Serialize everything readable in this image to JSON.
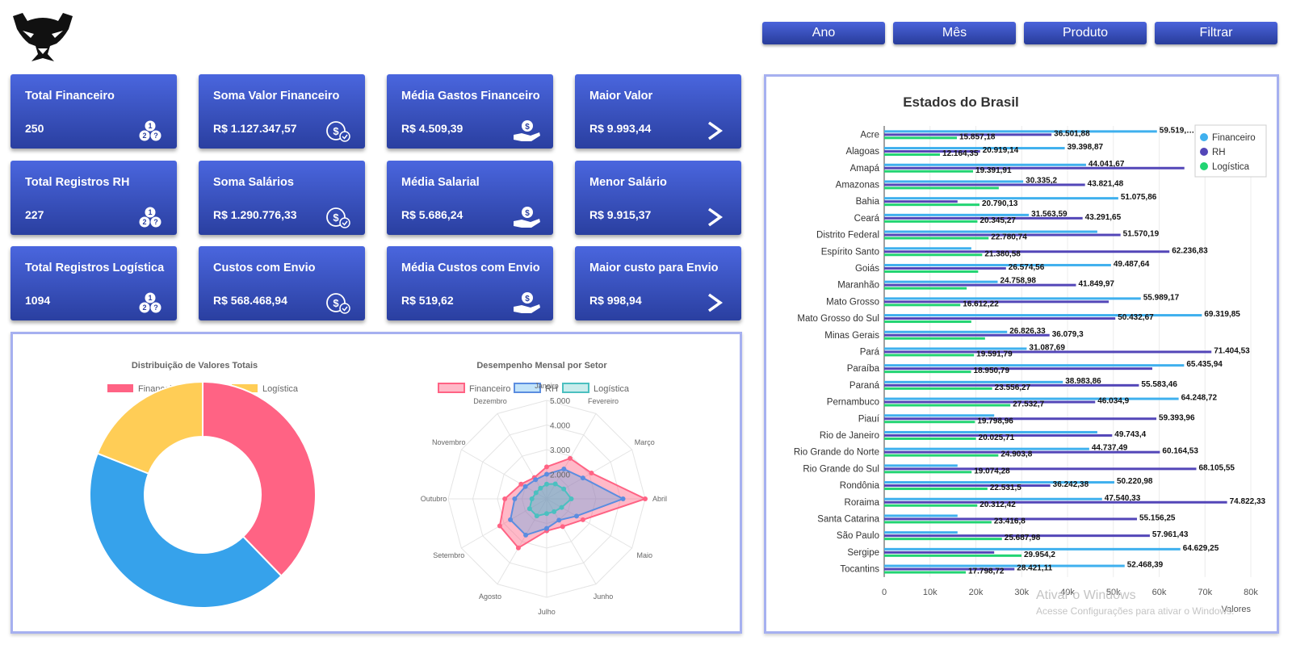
{
  "header": {
    "buttons": [
      "Ano",
      "Mês",
      "Produto",
      "Filtrar"
    ]
  },
  "icons": {
    "logo": "panda-logo",
    "counter": "numbered-coins-icon",
    "money": "money-check-icon",
    "hand": "money-hand-icon",
    "arrow": "chevron-right-icon"
  },
  "cards": [
    {
      "title": "Total Financeiro",
      "value": "250",
      "icon": "counter"
    },
    {
      "title": "Soma Valor Financeiro",
      "value": "R$ 1.127.347,57",
      "icon": "money"
    },
    {
      "title": "Média Gastos Financeiro",
      "value": "R$ 4.509,39",
      "icon": "hand"
    },
    {
      "title": "Maior Valor",
      "value": "R$ 9.993,44",
      "icon": "arrow"
    },
    {
      "title": "Total Registros RH",
      "value": "227",
      "icon": "counter"
    },
    {
      "title": "Soma Salários",
      "value": "R$ 1.290.776,33",
      "icon": "money"
    },
    {
      "title": "Média Salarial",
      "value": "R$ 5.686,24",
      "icon": "hand"
    },
    {
      "title": "Menor Salário",
      "value": "R$ 9.915,37",
      "icon": "arrow"
    },
    {
      "title": "Total Registros Logística",
      "value": "1094",
      "icon": "counter"
    },
    {
      "title": "Custos com Envio",
      "value": "R$ 568.468,94",
      "icon": "money"
    },
    {
      "title": "Média Custos com Envio",
      "value": "R$ 519,62",
      "icon": "hand"
    },
    {
      "title": "Maior custo para Envio",
      "value": "R$ 998,94",
      "icon": "arrow"
    }
  ],
  "colors": {
    "financeiro": "#ff6384",
    "rh": "#36a2eb",
    "logistica": "#ffcd56",
    "bar_financeiro": "#3fb0ee",
    "bar_rh": "#5346b8",
    "bar_logistica": "#22d472"
  },
  "watermark": {
    "line1": "Ativar o Windows",
    "line2": "Acesse Configurações para ativar o Windows."
  },
  "chart_data": [
    {
      "type": "pie",
      "variant": "doughnut",
      "title": "Distribuição de Valores Totais",
      "legend_position": "top",
      "categories": [
        "Financeiro",
        "RH",
        "Logística"
      ],
      "values": [
        1127347.57,
        1290776.33,
        568468.94
      ],
      "colors": [
        "#ff6384",
        "#36a2eb",
        "#ffcd56"
      ]
    },
    {
      "type": "radar",
      "title": "Desempenho Mensal por Setor",
      "legend_position": "top",
      "categories": [
        "Janeiro",
        "Fevereiro",
        "Março",
        "Abril",
        "Maio",
        "Junho",
        "Julho",
        "Agosto",
        "Setembro",
        "Outubro",
        "Novembro",
        "Dezembro"
      ],
      "r_ticks": [
        "2.000",
        "3.000",
        "4.000",
        "5.000"
      ],
      "r_range": [
        1000,
        5000
      ],
      "series": [
        {
          "name": "Financeiro",
          "values": [
            2300,
            2900,
            3100,
            5000,
            2700,
            2300,
            2300,
            3300,
            3200,
            2700,
            2200,
            2000
          ],
          "stroke": "#ff6384",
          "fill": "rgba(255,99,132,0.45)"
        },
        {
          "name": "RH",
          "values": [
            2000,
            2400,
            2700,
            4100,
            2400,
            2000,
            2200,
            2700,
            2700,
            2300,
            2000,
            1900
          ],
          "stroke": "#5b8de0",
          "fill": "rgba(54,162,235,0.30)"
        },
        {
          "name": "Logística",
          "values": [
            1600,
            1700,
            1800,
            2000,
            1700,
            1600,
            1600,
            1800,
            1800,
            1600,
            1500,
            1500
          ],
          "stroke": "#4bc0c0",
          "fill": "rgba(75,192,192,0.30)"
        }
      ]
    },
    {
      "type": "bar",
      "orientation": "horizontal",
      "title": "Estados do Brasil",
      "xlabel": "Valores",
      "xlim": [
        0,
        80000
      ],
      "x_ticks": [
        "0",
        "10k",
        "20k",
        "30k",
        "40k",
        "50k",
        "60k",
        "70k",
        "80k"
      ],
      "legend_position": "top-right",
      "categories": [
        "Acre",
        "Alagoas",
        "Amapá",
        "Amazonas",
        "Bahia",
        "Ceará",
        "Distrito Federal",
        "Espírito Santo",
        "Goiás",
        "Maranhão",
        "Mato Grosso",
        "Mato Grosso do Sul",
        "Minas Gerais",
        "Pará",
        "Paraíba",
        "Paraná",
        "Pernambuco",
        "Piauí",
        "Rio de Janeiro",
        "Rio Grande do Norte",
        "Rio Grande do Sul",
        "Rondônia",
        "Roraima",
        "Santa Catarina",
        "São Paulo",
        "Sergipe",
        "Tocantins"
      ],
      "series": [
        {
          "name": "Financeiro",
          "values": [
            59519,
            39398.87,
            44041.67,
            30335.2,
            51075.86,
            31563.59,
            46500,
            19000,
            49487.64,
            24758.98,
            55989.17,
            69319.85,
            26826.33,
            31087.69,
            65435.94,
            38983.86,
            64248.72,
            24000,
            46500,
            44737.49,
            16000,
            50220.98,
            47540.33,
            16000,
            16000,
            64629.25,
            52468.39
          ],
          "labels": [
            "59.519,…",
            "39.398,87",
            "44.041,67",
            "30.335,2",
            "51.075,86",
            "31.563,59",
            "",
            "",
            "49.487,64",
            "24.758,98",
            "55.989,17",
            "69.319,85",
            "26.826,33",
            "31.087,69",
            "65.435,94",
            "38.983,86",
            "64.248,72",
            "",
            "",
            "44.737,49",
            "",
            "50.220,98",
            "47.540,33",
            "",
            "",
            "64.629,25",
            "52.468,39"
          ]
        },
        {
          "name": "RH",
          "values": [
            36501.88,
            20919.14,
            65500,
            43821.48,
            16000,
            43291.65,
            51570.19,
            62236.83,
            26574.56,
            41849.97,
            49000,
            50432.67,
            36079.3,
            71404.53,
            58500,
            55583.46,
            46034.9,
            59393.96,
            49743.4,
            60164.53,
            68105.55,
            36242.38,
            74822.33,
            55156.25,
            57961.43,
            24000,
            28421.11
          ],
          "labels": [
            "36.501,88",
            "20.919,14",
            "",
            "43.821,48",
            "",
            "43.291,65",
            "51.570,19",
            "62.236,83",
            "26.574,56",
            "41.849,97",
            "",
            "50.432,67",
            "36.079,3",
            "71.404,53",
            "",
            "55.583,46",
            "46.034,9",
            "59.393,96",
            "49.743,4",
            "60.164,53",
            "68.105,55",
            "36.242,38",
            "74.822,33",
            "55.156,25",
            "57.961,43",
            "",
            "28.421,11"
          ]
        },
        {
          "name": "Logística",
          "values": [
            15857.18,
            12164.35,
            19391.91,
            25000,
            20790.13,
            20345.27,
            22780.74,
            21380.58,
            20500,
            18000,
            16612.22,
            19000,
            22000,
            19591.79,
            18950.79,
            23556.27,
            27532.7,
            19798.96,
            20025.71,
            24903.8,
            19074.28,
            22531.5,
            20312.42,
            23416.8,
            25687.98,
            29954.2,
            17798.72
          ],
          "labels": [
            "15.857,18",
            "12.164,35",
            "19.391,91",
            "",
            "20.790,13",
            "20.345,27",
            "22.780,74",
            "21.380,58",
            "",
            "",
            "16.612,22",
            "",
            "",
            "19.591,79",
            "18.950,79",
            "23.556,27",
            "27.532,7",
            "19.798,96",
            "20.025,71",
            "24.903,8",
            "19.074,28",
            "22.531,5",
            "20.312,42",
            "23.416,8",
            "25.687,98",
            "29.954,2",
            "17.798,72"
          ]
        }
      ]
    }
  ]
}
